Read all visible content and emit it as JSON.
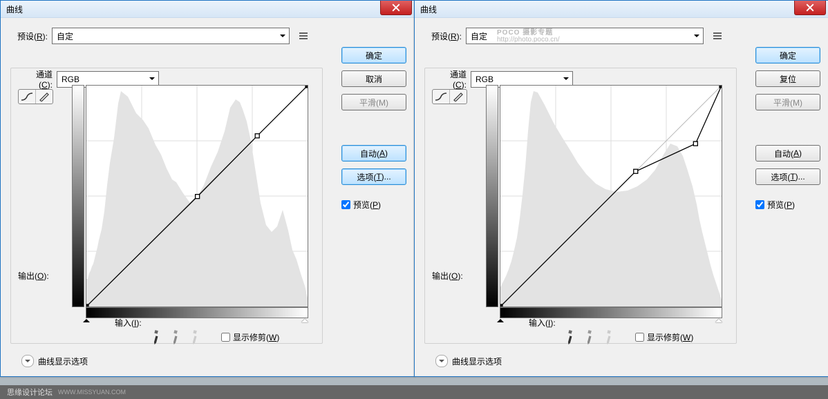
{
  "title": "曲线",
  "preset_label": "预设(<u>R</u>):",
  "channel_label": "通道(<u>C</u>):",
  "output_label": "输出(<u>O</u>):",
  "input_label": "输入(<u>I</u>):",
  "show_clip": "显示修剪(<u>W</u>)",
  "disclosure": "曲线显示选项",
  "preview": "预览(<u>P</u>)",
  "buttons": {
    "ok": "确定",
    "cancel": "取消",
    "reset": "复位",
    "smooth": "平滑(M)",
    "auto": "自动(<u>A</u>)",
    "options": "选项(<u>T</u>)..."
  },
  "footer_main": "思缘设计论坛",
  "footer_sub": "WWW.MISSYUAN.COM",
  "poco_main": "POCO 摄影专题",
  "poco_sub": "http://photo.poco.cn/",
  "left": {
    "preset_value": "自定",
    "channel_value": "RGB",
    "curve_points": [
      [
        0,
        255
      ],
      [
        128,
        128
      ],
      [
        197,
        58
      ],
      [
        255,
        0
      ]
    ],
    "histogram": "0,40 2,40 4,48 6,52 8,58 10,62 12,70 14,78 16,86 18,96 22,112 26,138 30,176 34,208 40,244 46,294 50,312 60,304 72,280 82,270 90,258 100,234 108,220 116,200 124,184 130,180 140,164 150,150 160,158 170,176 180,202 190,224 200,254 208,288 216,300 222,296 226,286 232,268 238,240 246,188 252,150 260,118 268,108 276,116 284,140 292,110 298,82 304,68 310,48 316,30 320,12 320,0 0,0"
  },
  "right": {
    "preset_value": "自定",
    "channel_value": "RGB",
    "curve_points": [
      [
        0,
        255
      ],
      [
        156,
        99
      ],
      [
        225,
        67
      ],
      [
        255,
        0
      ]
    ],
    "histogram": "0,28 4,36 8,44 12,54 16,66 20,82 24,100 28,128 32,162 36,202 40,254 44,296 48,312 54,310 64,292 78,264 90,244 100,228 112,208 124,192 138,178 152,170 168,166 184,168 198,174 212,184 224,198 236,220 246,236 256,232 264,218 270,200 278,174 284,148 288,126 292,108 296,92 300,76 304,60 308,46 312,34 316,22 320,10 320,0 0,0"
  }
}
